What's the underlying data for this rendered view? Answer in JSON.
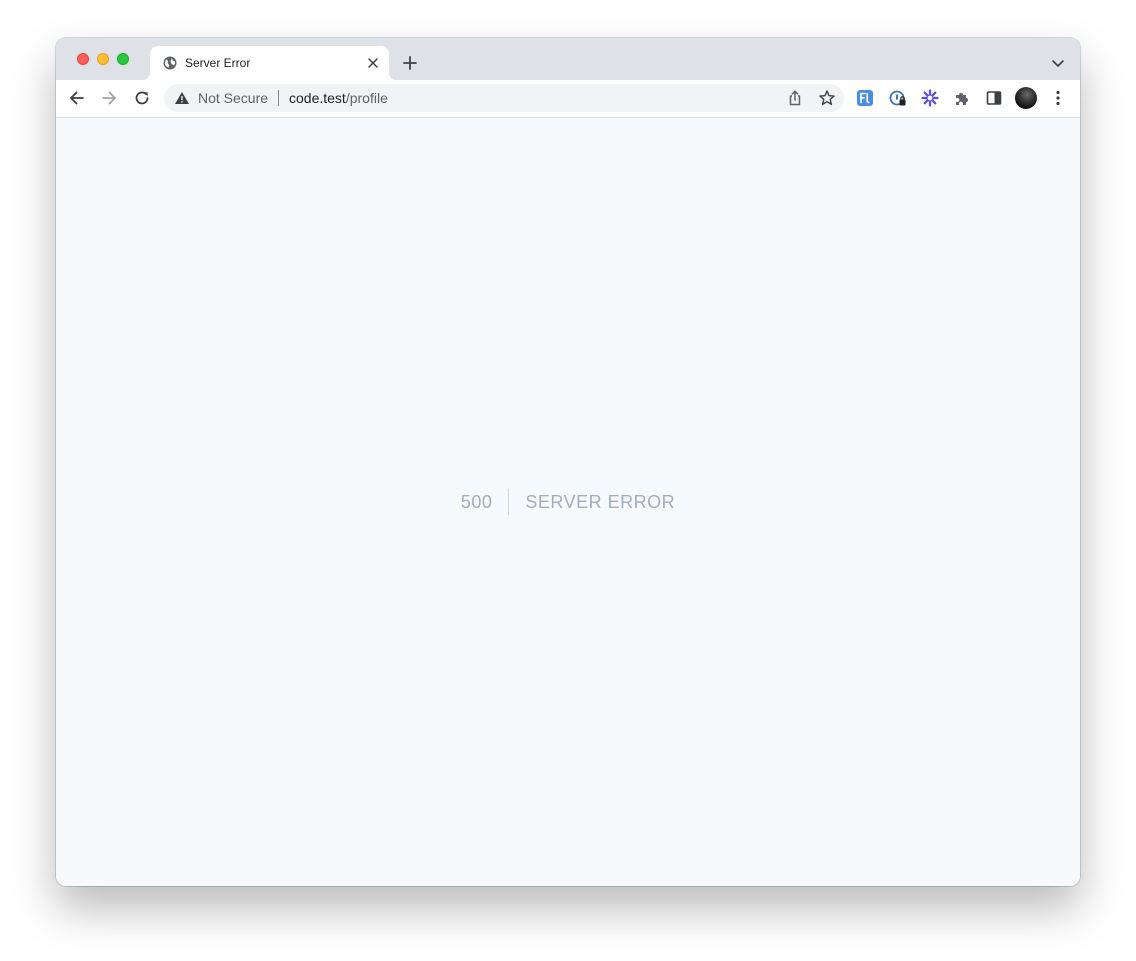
{
  "browser": {
    "tab": {
      "title": "Server Error",
      "favicon": "globe-icon"
    },
    "omnibox": {
      "security_label": "Not Secure",
      "url_host": "code.test",
      "url_path": "/profile"
    },
    "extensions": [
      {
        "name": "fl-extension-icon",
        "color": "#4a8ee0"
      },
      {
        "name": "password-manager-icon",
        "color": "#3c6fbf"
      },
      {
        "name": "asterisk-extension-icon",
        "color": "#5b4ce0"
      },
      {
        "name": "puzzle-icon",
        "color": "#5f6368"
      },
      {
        "name": "side-panel-icon",
        "color": "#5f6368"
      }
    ]
  },
  "page": {
    "error_code": "500",
    "error_message": "Server Error",
    "colors": {
      "background": "#f7fafc",
      "text": "#a0aec0",
      "divider": "#cbd5e0"
    }
  }
}
